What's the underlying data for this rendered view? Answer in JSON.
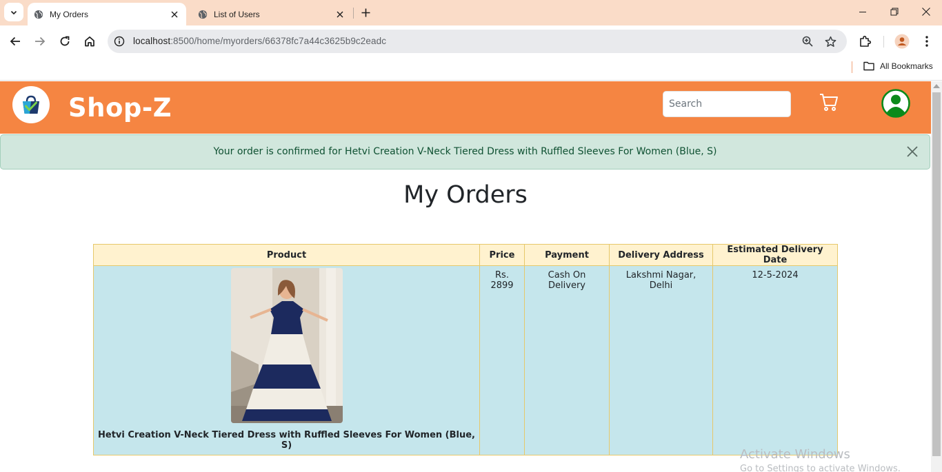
{
  "browser": {
    "tabs": [
      {
        "title": "My Orders",
        "active": true
      },
      {
        "title": "List of Users",
        "active": false
      }
    ],
    "url_host": "localhost",
    "url_rest": ":8500/home/myorders/66378fc7a44c3625b9c2eadc",
    "bookmarks_label": "All Bookmarks"
  },
  "navbar": {
    "brand": "Shop-Z",
    "search_placeholder": "Search"
  },
  "alert": {
    "message": "Your order is confirmed for Hetvi Creation V-Neck Tiered Dress with Ruffled Sleeves For Women (Blue, S)"
  },
  "page": {
    "heading": "My Orders"
  },
  "orders": {
    "columns": [
      "Product",
      "Price",
      "Payment",
      "Delivery Address",
      "Estimated Delivery Date"
    ],
    "rows": [
      {
        "product": "Hetvi Creation V-Neck Tiered Dress with Ruffled Sleeves For Women (Blue, S)",
        "price": "Rs. 2899",
        "payment": "Cash On Delivery",
        "address": "Lakshmi Nagar, Delhi",
        "delivery_date": "12-5-2024"
      }
    ]
  },
  "watermark": {
    "line1": "Activate Windows",
    "line2": "Go to Settings to activate Windows."
  },
  "colors": {
    "navbar": "#f58542",
    "alert_bg": "#d1e7dd",
    "table_header": "#fff2cf",
    "table_row": "#c5e6ec"
  }
}
